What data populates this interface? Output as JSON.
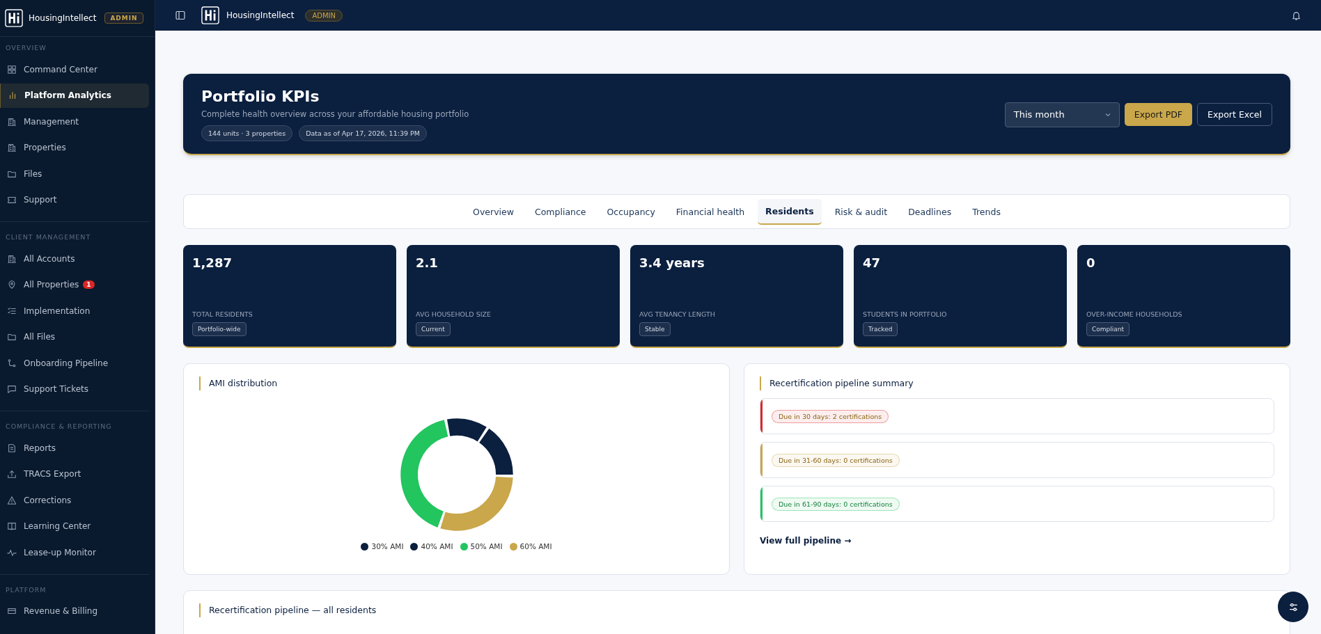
{
  "sidebar": {
    "brand": "HousingIntellect",
    "role_badge": "ADMIN",
    "sections": [
      {
        "label": "OVERVIEW",
        "items": [
          {
            "label": "Command Center",
            "selected": false
          },
          {
            "label": "Platform Analytics",
            "selected": true
          },
          {
            "label": "Management",
            "selected": false
          },
          {
            "label": "Properties",
            "selected": false
          },
          {
            "label": "Files",
            "selected": false
          },
          {
            "label": "Support",
            "selected": false
          }
        ]
      },
      {
        "label": "CLIENT MANAGEMENT",
        "items": [
          {
            "label": "All Accounts",
            "selected": false
          },
          {
            "label": "All Properties",
            "selected": false,
            "badge": "1"
          },
          {
            "label": "Implementation",
            "selected": false
          },
          {
            "label": "All Files",
            "selected": false
          },
          {
            "label": "Onboarding Pipeline",
            "selected": false
          },
          {
            "label": "Support Tickets",
            "selected": false
          }
        ]
      },
      {
        "label": "COMPLIANCE & REPORTING",
        "items": [
          {
            "label": "Reports",
            "selected": false
          },
          {
            "label": "TRACS Export",
            "selected": false
          },
          {
            "label": "Corrections",
            "selected": false
          },
          {
            "label": "Learning Center",
            "selected": false
          },
          {
            "label": "Lease-up Monitor",
            "selected": false
          }
        ]
      },
      {
        "label": "PLATFORM",
        "items": [
          {
            "label": "Revenue & Billing",
            "selected": false
          }
        ]
      }
    ]
  },
  "topbar": {
    "brand": "HousingIntellect",
    "role_badge": "ADMIN"
  },
  "banner": {
    "title": "Portfolio KPIs",
    "subtitle": "Complete health overview across your affordable housing portfolio",
    "chips": [
      "144 units · 3 properties",
      "Data as of Apr 17, 2026, 11:39 PM"
    ],
    "period": {
      "value": "This month"
    },
    "buttons": [
      "Export PDF",
      "Export Excel"
    ]
  },
  "tabs": [
    {
      "label": "Overview",
      "selected": false
    },
    {
      "label": "Compliance",
      "selected": false
    },
    {
      "label": "Occupancy",
      "selected": false
    },
    {
      "label": "Financial health",
      "selected": false
    },
    {
      "label": "Residents",
      "selected": true
    },
    {
      "label": "Risk & audit",
      "selected": false
    },
    {
      "label": "Deadlines",
      "selected": false
    },
    {
      "label": "Trends",
      "selected": false
    }
  ],
  "kpis": [
    {
      "value": "1,287",
      "label": "TOTAL RESIDENTS",
      "tag": "Portfolio-wide"
    },
    {
      "value": "2.1",
      "label": "AVG HOUSEHOLD SIZE",
      "tag": "Current"
    },
    {
      "value": "3.4 years",
      "label": "AVG TENANCY LENGTH",
      "tag": "Stable"
    },
    {
      "value": "47",
      "label": "STUDENTS IN PORTFOLIO",
      "tag": "Tracked"
    },
    {
      "value": "0",
      "label": "OVER-INCOME HOUSEHOLDS",
      "tag": "Compliant"
    }
  ],
  "ami_panel": {
    "title": "AMI distribution",
    "legend": [
      {
        "label": "30% AMI",
        "color": "#0b1f3f"
      },
      {
        "label": "40% AMI",
        "color": "#0b1f3f"
      },
      {
        "label": "50% AMI",
        "color": "#22c55e"
      },
      {
        "label": "60% AMI",
        "color": "#c9a74a"
      }
    ]
  },
  "pipeline_panel": {
    "title": "Recertification pipeline summary",
    "items": [
      {
        "label": "Due in 30 days: 2 certifications",
        "color": "#dc2626"
      },
      {
        "label": "Due in 31-60 days: 0 certifications",
        "color": "#c9a74a"
      },
      {
        "label": "Due in 61-90 days: 0 certifications",
        "color": "#22c55e"
      }
    ],
    "link": "View full pipeline →"
  },
  "residents_panel": {
    "title": "Recertification pipeline — all residents"
  }
}
